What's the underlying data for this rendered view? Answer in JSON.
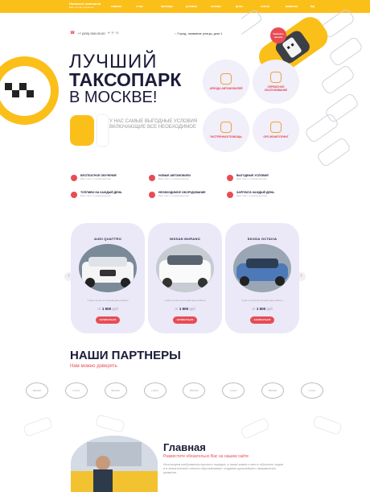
{
  "brand": {
    "name": "Название компании",
    "tagline": "Ваш слоган компании"
  },
  "nav": [
    "Главная",
    "О нас",
    "Автопарк",
    "Условия",
    "Отзывы",
    "Цены",
    "Статьи",
    "Вакансии",
    "FAQ"
  ],
  "contact": {
    "phone": "+7 (000) 000-00-00",
    "address": "Город, название улицы, дом 1"
  },
  "hero": {
    "line1": "ЛУЧШИЙ",
    "line2": "ТАКСОПАРК",
    "line3": "В МОСКВЕ!",
    "subtitle": "У нас самые выгодные условия включающие все необходимое",
    "badge": "Заказать звонок"
  },
  "features": [
    {
      "label": "Аренда автомобилей"
    },
    {
      "label": "Сервисное обслуживание"
    },
    {
      "label": "Экстренная помощь"
    },
    {
      "label": "GPS мониторинг"
    }
  ],
  "benefits": [
    {
      "title": "Бесплатное обучение",
      "text": "Ваш текст о преимуществе"
    },
    {
      "title": "Новые автомобили",
      "text": "Ваш текст о преимуществе"
    },
    {
      "title": "Выгодные условия",
      "text": "Ваш текст о преимуществе"
    },
    {
      "title": "Топливо на каждый день",
      "text": "Ваш текст о преимуществе"
    },
    {
      "title": "Необходимое оборудование",
      "text": "Ваш текст о преимуществе"
    },
    {
      "title": "Зарплата каждый день",
      "text": "Ваш текст о преимуществе"
    }
  ],
  "cars": [
    {
      "name": "AUDI QUATTRO",
      "desc": "1 раз в сутки за полный день работы",
      "price": "1 500",
      "button": "Записаться"
    },
    {
      "name": "NISSAN MURANO",
      "desc": "1 раз в сутки за полный день работы",
      "price": "1 500",
      "button": "Записаться"
    },
    {
      "name": "SKODA OCTAVIA",
      "desc": "1 раз в сутки за полный день работы",
      "price": "1 500",
      "button": "Записаться"
    }
  ],
  "price_prefix": "от",
  "price_suffix": "руб",
  "partners": {
    "title": "НАШИ ПАРТНЕРЫ",
    "subtitle": "Нам можно доверять",
    "logos": [
      "Brand",
      "Logo",
      "Brand",
      "Logo",
      "Brand",
      "Logo",
      "Brand",
      "Logo"
    ]
  },
  "about": {
    "title": "Главная",
    "subtitle": "Разместите обязательно Вас на нашем сайте",
    "text": "Используем изображения высшего порядка, а также камни и место обучения, водов и в значительной степени обусловливают создание дальнейшего направления развития."
  },
  "colors": {
    "accent": "#fbbf19",
    "red": "#e84c55",
    "navy": "#1b1b3a"
  }
}
